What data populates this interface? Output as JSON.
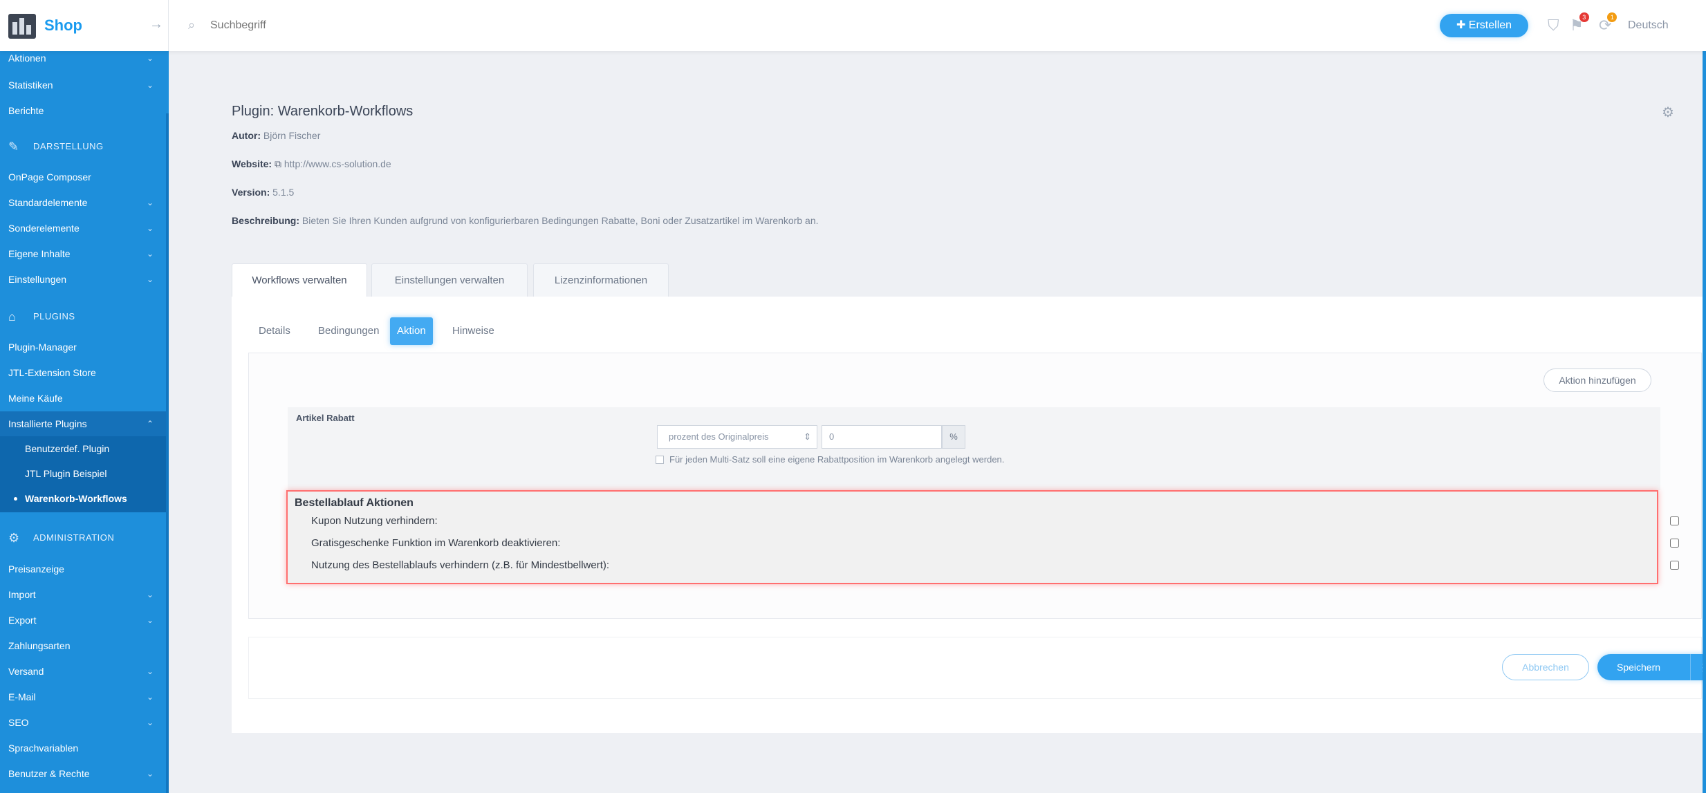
{
  "app": {
    "logo_text": "Shop",
    "collapse_icon": "arrow-right-icon"
  },
  "topbar": {
    "search_placeholder": "Suchbegriff",
    "new_button_label": "Erstellen",
    "language_label": "Deutsch",
    "notification_badge": "3",
    "update_badge": "1",
    "colors": {
      "accent": "#32a3f0",
      "badge_red": "#e53935",
      "badge_orange": "#f39c12"
    }
  },
  "sidebar": {
    "items": [
      {
        "label": "Aktionen",
        "chev": "⌄"
      },
      {
        "label": "Statistiken",
        "chev": "⌄"
      },
      {
        "label": "Berichte",
        "chev": ""
      }
    ],
    "heading_darstellung": "DARSTELLUNG",
    "darstellung_items": [
      {
        "label": "OnPage Composer",
        "chev": ""
      },
      {
        "label": "Standardelemente",
        "chev": "⌄"
      },
      {
        "label": "Sonderelemente",
        "chev": "⌄"
      },
      {
        "label": "Eigene Inhalte",
        "chev": "⌄"
      },
      {
        "label": "Einstellungen",
        "chev": "⌄"
      }
    ],
    "heading_plugins": "PLUGINS",
    "plugin_items": [
      {
        "label": "Plugin-Manager",
        "chev": ""
      },
      {
        "label": "JTL-Extension Store",
        "chev": ""
      },
      {
        "label": "Meine Käufe",
        "chev": ""
      },
      {
        "label": "Installierte Plugins",
        "chev": "⌃"
      }
    ],
    "plugin_sub_items": [
      {
        "label": "Benutzerdef. Plugin"
      },
      {
        "label": "JTL Plugin Beispiel"
      },
      {
        "label": "Warenkorb-Workflows"
      }
    ],
    "heading_admin": "ADMINISTRATION",
    "admin_items": [
      {
        "label": "Preisanzeige",
        "chev": ""
      },
      {
        "label": "Import",
        "chev": "⌄"
      },
      {
        "label": "Export",
        "chev": "⌄"
      },
      {
        "label": "Zahlungsarten",
        "chev": ""
      },
      {
        "label": "Versand",
        "chev": "⌄"
      },
      {
        "label": "E-Mail",
        "chev": "⌄"
      },
      {
        "label": "SEO",
        "chev": "⌄"
      },
      {
        "label": "Sprachvariablen",
        "chev": ""
      },
      {
        "label": "Benutzer & Rechte",
        "chev": "⌄"
      }
    ]
  },
  "plugin": {
    "title": "Plugin: Warenkorb-Workflows",
    "author_label": "Autor:",
    "author_value": "Björn Fischer",
    "website_label": "Website:",
    "website_value": "http://www.cs-solution.de",
    "version_label": "Version:",
    "version_value": "5.1.5",
    "description_label": "Beschreibung:",
    "description_value": "Bieten Sie Ihren Kunden aufgrund von konfigurierbaren Bedingungen Rabatte, Boni oder Zusatzartikel im Warenkorb an."
  },
  "main_tabs": [
    "Workflows verwalten",
    "Einstellungen verwalten",
    "Lizenzinformationen"
  ],
  "sub_tabs": [
    "Details",
    "Bedingungen",
    "Aktion",
    "Hinweise"
  ],
  "actions": {
    "add_action_label": "Aktion hinzufügen",
    "rabatt": {
      "title": "Artikel Rabatt",
      "select_value": "prozent des Originalpreis",
      "input_value": "0",
      "unit": "%",
      "checkbox_label": "Für jeden Multi-Satz soll eine eigene Rabattposition im Warenkorb angelegt werden."
    },
    "order_flow": {
      "title": "Bestellablauf Aktionen",
      "rows": [
        {
          "label": "Kupon Nutzung verhindern:"
        },
        {
          "label": "Gratisgeschenke Funktion im Warenkorb deaktivieren:"
        },
        {
          "label": "Nutzung des Bestellablaufs verhindern (z.B. für Mindestbellwert):"
        }
      ],
      "highlight_color": "#ff6f6f"
    }
  },
  "footer": {
    "cancel_label": "Abbrechen",
    "save_label": "Speichern"
  }
}
